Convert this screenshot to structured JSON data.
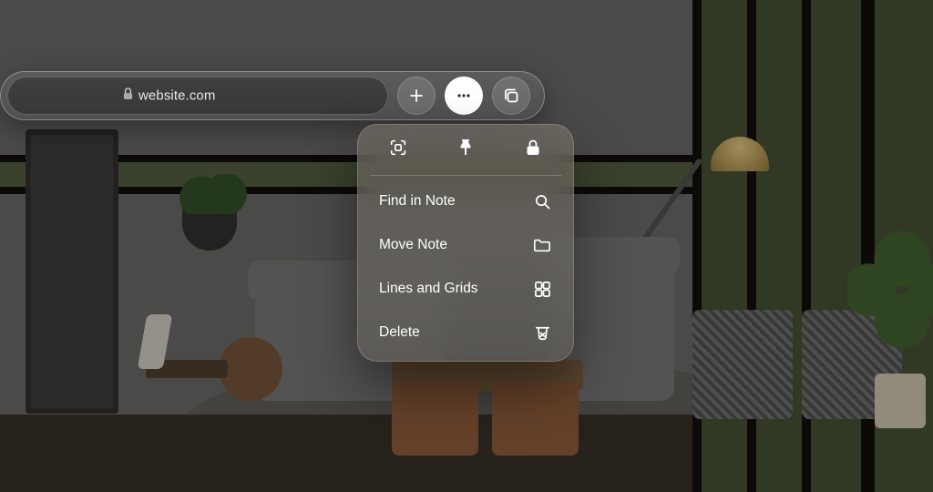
{
  "toolbar": {
    "url": "website.com",
    "add_label": "Add",
    "more_label": "More",
    "tabs_label": "Tabs"
  },
  "panel": {
    "top": {
      "scan_label": "Scan",
      "pin_label": "Pin",
      "lock_label": "Lock"
    },
    "items": [
      {
        "label": "Find in Note",
        "icon": "search-icon"
      },
      {
        "label": "Move Note",
        "icon": "folder-icon"
      },
      {
        "label": "Lines and Grids",
        "icon": "grid-icon"
      },
      {
        "label": "Delete",
        "icon": "trash-icon"
      }
    ]
  }
}
